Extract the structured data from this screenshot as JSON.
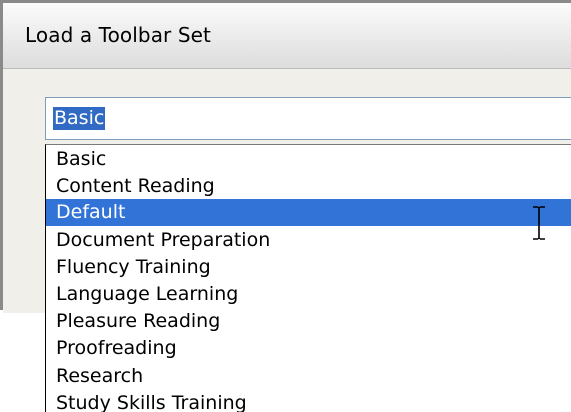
{
  "dialog": {
    "title": "Load a Toolbar Set"
  },
  "combo": {
    "value": "Basic"
  },
  "dropdown": {
    "options": [
      {
        "label": "Basic",
        "selected": false
      },
      {
        "label": "Content Reading",
        "selected": false
      },
      {
        "label": "Default",
        "selected": true
      },
      {
        "label": "Document Preparation",
        "selected": false
      },
      {
        "label": "Fluency Training",
        "selected": false
      },
      {
        "label": "Language Learning",
        "selected": false
      },
      {
        "label": "Pleasure Reading",
        "selected": false
      },
      {
        "label": "Proofreading",
        "selected": false
      },
      {
        "label": "Research",
        "selected": false
      },
      {
        "label": "Study Skills Training",
        "selected": false
      }
    ]
  },
  "colors": {
    "selection": "#3173d7",
    "text_selection": "#316ac5",
    "dialog_face": "#f0efe9"
  },
  "cursor": {
    "icon": "text-cursor-icon"
  }
}
